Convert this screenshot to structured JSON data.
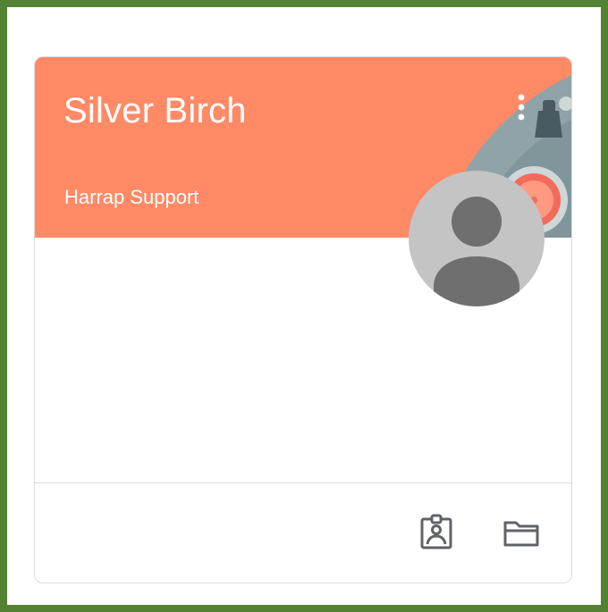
{
  "card": {
    "class_name": "Silver Birch",
    "section": "Harrap Support",
    "header_color": "#ff8a65",
    "more_options_icon": "more-vert-icon",
    "avatar_icon": "default-person-icon"
  },
  "footer": {
    "actions": [
      {
        "icon": "assignment-ind-icon"
      },
      {
        "icon": "folder-icon"
      }
    ]
  },
  "frame": {
    "border_color": "#548235"
  }
}
